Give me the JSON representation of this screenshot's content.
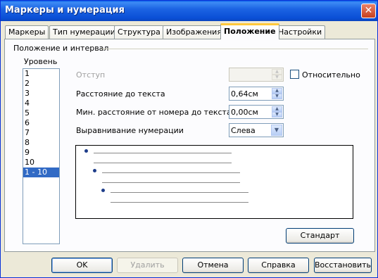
{
  "window": {
    "title": "Маркеры и нумерация",
    "close_glyph": "✕"
  },
  "tabs": [
    {
      "label": "Маркеры"
    },
    {
      "label": "Тип нумерации"
    },
    {
      "label": "Структура"
    },
    {
      "label": "Изображения"
    },
    {
      "label": "Положение",
      "active": true
    },
    {
      "label": "Настройки"
    }
  ],
  "position": {
    "group_label": "Положение и интервал",
    "level_label": "Уровень",
    "levels": [
      "1",
      "2",
      "3",
      "4",
      "5",
      "6",
      "7",
      "8",
      "9",
      "10",
      "1 - 10"
    ],
    "selected_level": "1 - 10",
    "indent_label": "Отступ",
    "indent_value": "",
    "relative_label": "Относительно",
    "relative_checked": false,
    "spacing_label": "Расстояние до текста",
    "spacing_value": "0,64см",
    "min_spacing_label": "Мин. расстояние от номера до текста",
    "min_spacing_value": "0,00см",
    "align_label": "Выравнивание нумерации",
    "align_value": "Слева",
    "standard_button": "Стандарт"
  },
  "buttons": {
    "ok": "OK",
    "delete": "Удалить",
    "cancel": "Отмена",
    "help": "Справка",
    "restore": "Восстановить"
  },
  "colors": {
    "title_bar": "#0a5fe8",
    "bullet": "#1e3d8a",
    "selection": "#316ac5"
  }
}
